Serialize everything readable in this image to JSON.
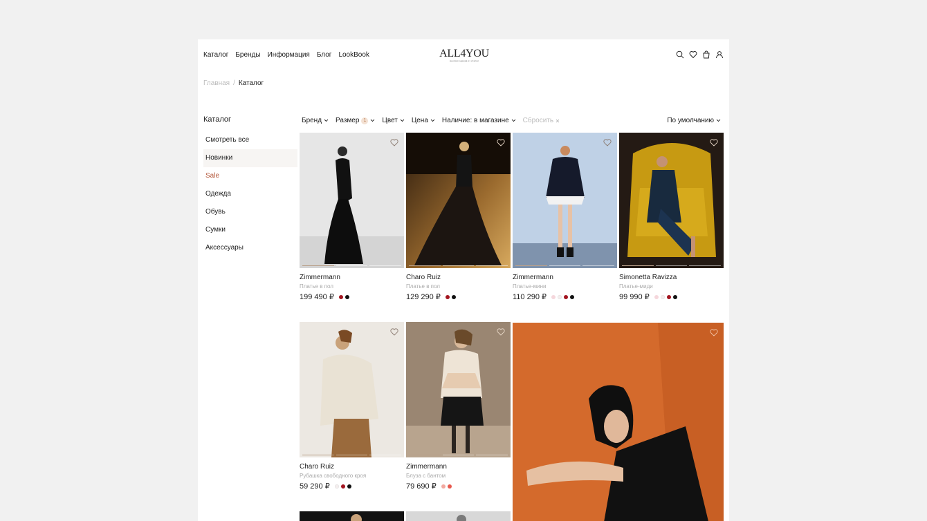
{
  "header": {
    "nav": [
      "Каталог",
      "Бренды",
      "Информация",
      "Блог",
      "LookBook"
    ],
    "logo_main": "ALL4YOU",
    "logo_sub": "женская одежда из италии",
    "icons": [
      "search-icon",
      "heart-icon",
      "bag-icon",
      "user-icon"
    ]
  },
  "breadcrumb": {
    "home": "Главная",
    "separator": "/",
    "current": "Каталог"
  },
  "sidebar": {
    "title": "Каталог",
    "items": [
      {
        "label": "Смотреть все"
      },
      {
        "label": "Новинки",
        "active": true
      },
      {
        "label": "Sale",
        "accent": "#b4573a"
      },
      {
        "label": "Одежда"
      },
      {
        "label": "Обувь"
      },
      {
        "label": "Сумки"
      },
      {
        "label": "Аксессуары"
      }
    ]
  },
  "filters": {
    "brand": "Бренд",
    "size": "Размер",
    "size_count": "1",
    "color": "Цвет",
    "price": "Цена",
    "availability": "Наличие: в магазине",
    "reset": "Сбросить",
    "sort": "По умолчанию"
  },
  "products": [
    {
      "brand": "Zimmermann",
      "type": "Платье в пол",
      "price": "199 490 ₽",
      "colors": [
        "#a31520",
        "#111111"
      ]
    },
    {
      "brand": "Charo Ruiz",
      "type": "Платье в пол",
      "price": "129 290 ₽",
      "colors": [
        "#a31520",
        "#111111"
      ]
    },
    {
      "brand": "Zimmermann",
      "type": "Платье-мини",
      "price": "110 290 ₽",
      "colors": [
        "#f5d7dc",
        "#f4eeee",
        "#a31520",
        "#111111"
      ]
    },
    {
      "brand": "Simonetta Ravizza",
      "type": "Платье-миди",
      "price": "99 990 ₽",
      "colors": [
        "#f5d7dc",
        "#f4eeee",
        "#a31520",
        "#111111"
      ]
    },
    {
      "brand": "Charo Ruiz",
      "type": "Рубашка свободного кроя",
      "price": "59 290 ₽",
      "colors": [
        "#f4eeee",
        "#a31520",
        "#111111"
      ]
    },
    {
      "brand": "Zimmermann",
      "type": "Блуза с бантом",
      "price": "79 690 ₽",
      "colors": [
        "#f2a9a0",
        "#e85a4f"
      ]
    }
  ],
  "accent_color": "#b4573a"
}
